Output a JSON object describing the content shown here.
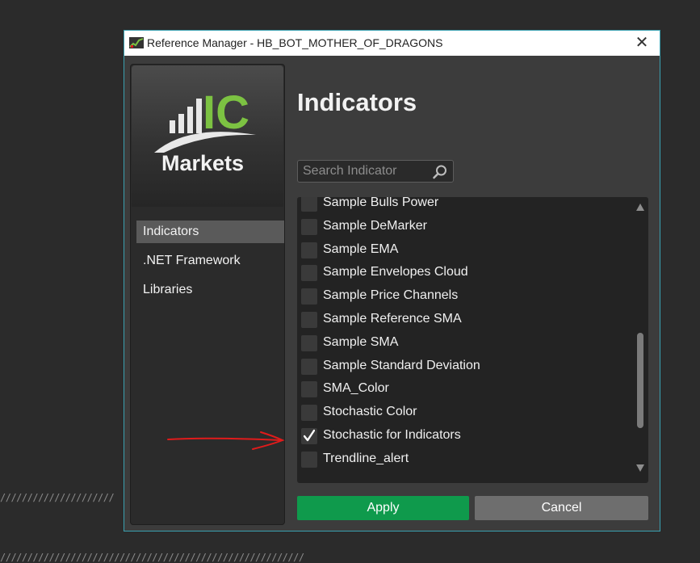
{
  "window": {
    "title": "Reference Manager - HB_BOT_MOTHER_OF_DRAGONS",
    "close_glyph": "✕"
  },
  "logo": {
    "brand_letters": "IC",
    "brand_word": "Markets"
  },
  "sidebar": {
    "items": [
      {
        "label": "Indicators",
        "active": true
      },
      {
        "label": ".NET Framework",
        "active": false
      },
      {
        "label": "Libraries",
        "active": false
      }
    ]
  },
  "main": {
    "title": "Indicators",
    "search": {
      "placeholder": "Search Indicator",
      "value": ""
    },
    "items": [
      {
        "label": "Sample Bulls Power",
        "checked": false
      },
      {
        "label": "Sample DeMarker",
        "checked": false
      },
      {
        "label": "Sample EMA",
        "checked": false
      },
      {
        "label": "Sample Envelopes Cloud",
        "checked": false
      },
      {
        "label": "Sample Price Channels",
        "checked": false
      },
      {
        "label": "Sample Reference SMA",
        "checked": false
      },
      {
        "label": "Sample SMA",
        "checked": false
      },
      {
        "label": "Sample Standard Deviation",
        "checked": false
      },
      {
        "label": "SMA_Color",
        "checked": false
      },
      {
        "label": "Stochastic Color",
        "checked": false
      },
      {
        "label": "Stochastic for Indicators",
        "checked": true
      },
      {
        "label": "Trendline_alert",
        "checked": false
      }
    ]
  },
  "buttons": {
    "apply": "Apply",
    "cancel": "Cancel"
  },
  "background": {
    "hatch_top": "/////////////////////",
    "hatch_bottom": "////////////////////////////////////////////////////////"
  },
  "colors": {
    "accent": "#0f9a4c",
    "brand_green": "#7cc242",
    "annotation": "#e01b1b",
    "window_border": "#3aa0b0"
  }
}
